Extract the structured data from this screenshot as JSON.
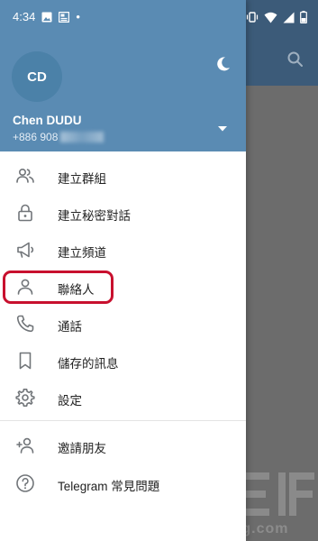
{
  "status_bar": {
    "time": "4:34",
    "dot": "•"
  },
  "account": {
    "initials": "CD",
    "name": "Chen DUDU",
    "phone_visible": "+886 908"
  },
  "menu": {
    "items": [
      {
        "label": "建立群組",
        "icon": "group-icon"
      },
      {
        "label": "建立秘密對話",
        "icon": "lock-icon"
      },
      {
        "label": "建立頻道",
        "icon": "megaphone-icon"
      },
      {
        "label": "聯絡人",
        "icon": "person-icon"
      },
      {
        "label": "通話",
        "icon": "phone-icon"
      },
      {
        "label": "儲存的訊息",
        "icon": "bookmark-icon"
      },
      {
        "label": "設定",
        "icon": "gear-icon"
      },
      {
        "label": "邀請朋友",
        "icon": "add-person-icon"
      },
      {
        "label": "Telegram 常見問題",
        "icon": "question-icon"
      }
    ]
  },
  "watermark": {
    "site": "techbang.com"
  },
  "colors": {
    "drawer_header": "#5a8bb3",
    "avatar": "#4b81a8",
    "highlight": "#c8102e",
    "icon": "#717579"
  }
}
